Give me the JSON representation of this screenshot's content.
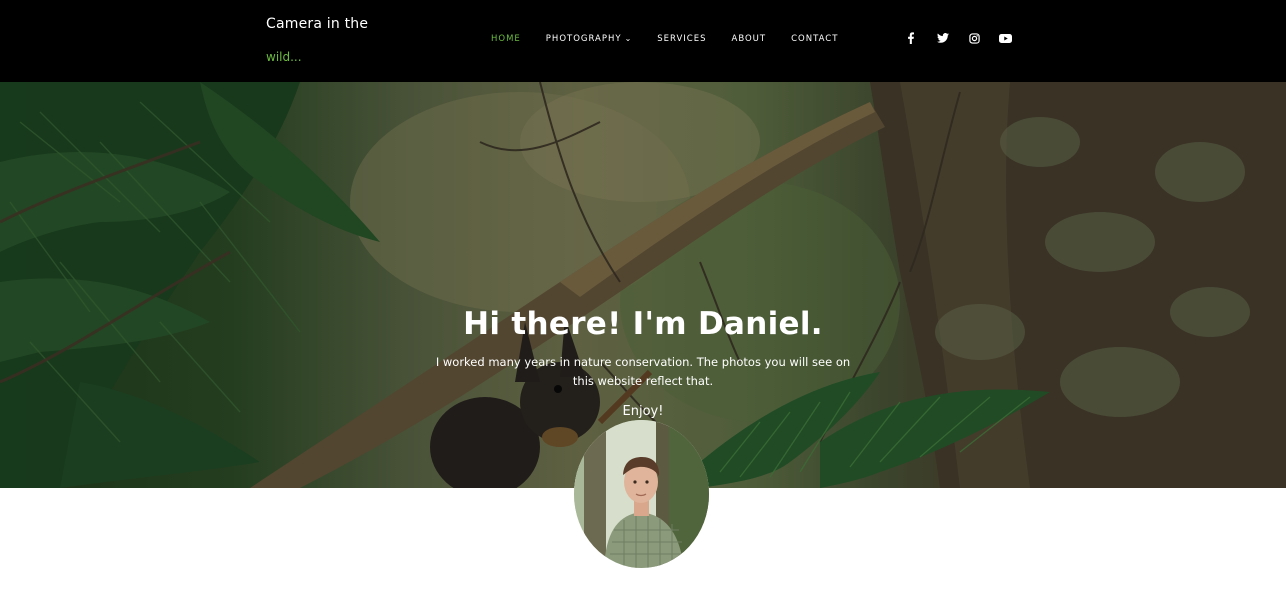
{
  "header": {
    "logo_line1": "Camera in the",
    "logo_line2": "wild..."
  },
  "nav": {
    "items": [
      {
        "label": "HOME",
        "active": true
      },
      {
        "label": "PHOTOGRAPHY",
        "dropdown": true
      },
      {
        "label": "SERVICES"
      },
      {
        "label": "ABOUT"
      },
      {
        "label": "CONTACT"
      }
    ]
  },
  "social": [
    "facebook-icon",
    "twitter-icon",
    "instagram-icon",
    "youtube-icon"
  ],
  "hero": {
    "title": "Hi there! I'm Daniel.",
    "text": "I worked many years in nature conservation. The photos you will see on this website reflect that.",
    "enjoy": "Enjoy!"
  },
  "colors": {
    "accent": "#6bbd3f",
    "header_bg": "#000000"
  }
}
